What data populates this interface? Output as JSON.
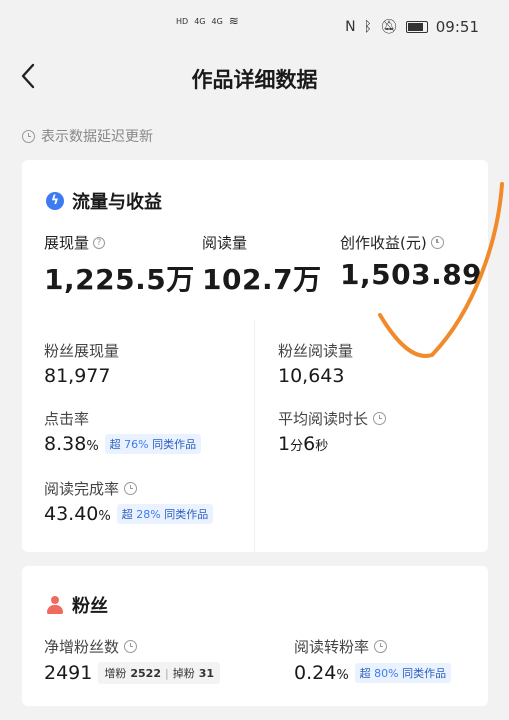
{
  "status_bar": {
    "left_indicators": [
      "HD",
      "4G",
      "4G"
    ],
    "time": "09:51",
    "icons": [
      "nfc-icon",
      "bluetooth-icon",
      "mute-icon",
      "battery-icon"
    ]
  },
  "nav": {
    "title": "作品详细数据",
    "back_icon": "back-arrow-icon"
  },
  "notice": {
    "text": "表示数据延迟更新",
    "icon": "clock-icon"
  },
  "flow_card": {
    "title": "流量与收益",
    "impressions": {
      "label": "展现量",
      "value": "1,225.5",
      "unit": "万"
    },
    "reads": {
      "label": "阅读量",
      "value": "102.7",
      "unit": "万"
    },
    "earnings": {
      "label": "创作收益(元)",
      "value": "1,503.89"
    },
    "fan_impressions": {
      "label": "粉丝展现量",
      "value": "81,977"
    },
    "fan_reads": {
      "label": "粉丝阅读量",
      "value": "10,643"
    },
    "ctr": {
      "label": "点击率",
      "value": "8.38",
      "unit": "%",
      "badge_prefix": "超",
      "badge_pct": "76%",
      "badge_suffix": "同类作品"
    },
    "avg_read_time": {
      "label": "平均阅读时长",
      "minutes": "1",
      "min_unit": "分",
      "seconds": "6",
      "sec_unit": "秒"
    },
    "completion": {
      "label": "阅读完成率",
      "value": "43.40",
      "unit": "%",
      "badge_prefix": "超",
      "badge_pct": "28%",
      "badge_suffix": "同类作品"
    }
  },
  "fans_card": {
    "title": "粉丝",
    "net_gain": {
      "label": "净增粉丝数",
      "value": "2491",
      "gain_label": "增粉",
      "gain_value": "2522",
      "loss_label": "掉粉",
      "loss_value": "31"
    },
    "conversion": {
      "label": "阅读转粉率",
      "value": "0.24",
      "unit": "%",
      "badge_prefix": "超",
      "badge_pct": "80%",
      "badge_suffix": "同类作品"
    }
  },
  "colors": {
    "accent_blue": "#3d7cf0",
    "fans_red": "#f06a5f",
    "annotation_orange": "#f08a2a"
  }
}
